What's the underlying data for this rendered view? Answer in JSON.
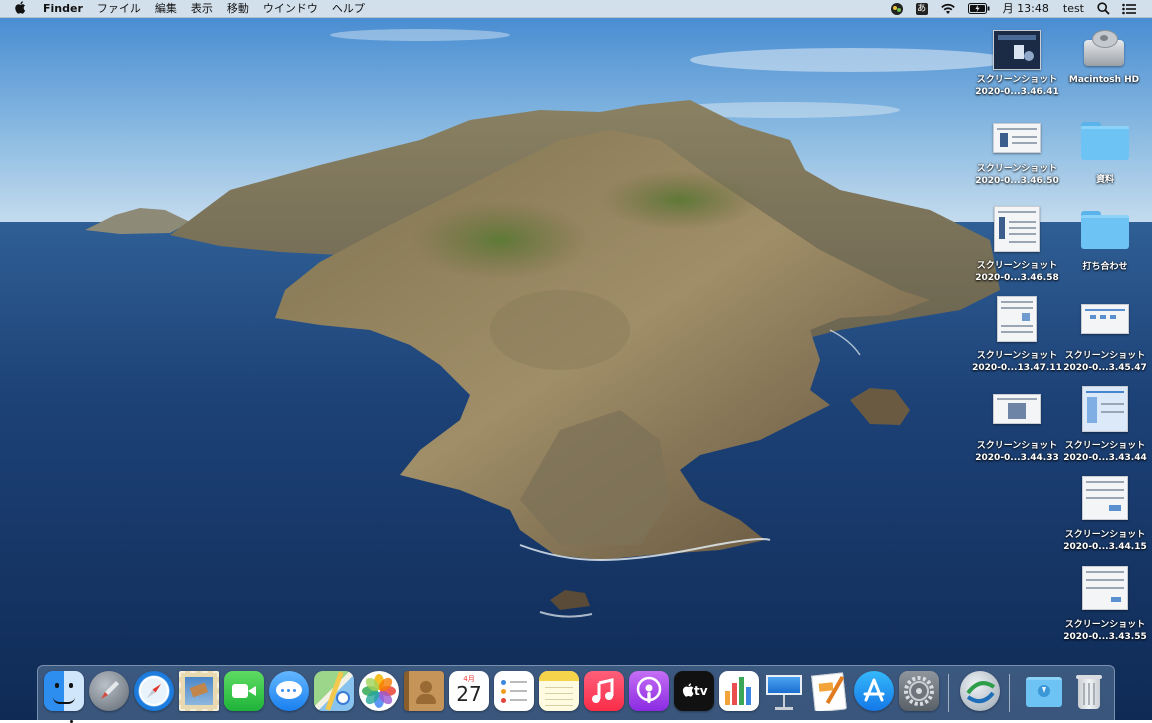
{
  "menubar": {
    "apple_icon": "apple-logo-icon",
    "app_name": "Finder",
    "menus": [
      "ファイル",
      "編集",
      "表示",
      "移動",
      "ウインドウ",
      "ヘルプ"
    ],
    "status": {
      "ime_label": "あ",
      "battery_icon": "battery-charging-icon",
      "wifi_icon": "wifi-icon",
      "clock": "月 13:48",
      "user": "test",
      "search_icon": "spotlight-search-icon",
      "notification_icon": "notification-center-icon"
    }
  },
  "desktop": {
    "icons": [
      {
        "line1": "スクリーンショット",
        "line2": "2020-0...3.46.41",
        "kind": "screenshot-dark"
      },
      {
        "line1": "Macintosh HD",
        "line2": "",
        "kind": "disk"
      },
      {
        "line1": "スクリーンショット",
        "line2": "2020-0...3.46.50",
        "kind": "screenshot"
      },
      {
        "line1": "資料",
        "line2": "",
        "kind": "folder"
      },
      {
        "line1": "スクリーンショット",
        "line2": "2020-0...3.46.58",
        "kind": "screenshot-tall"
      },
      {
        "line1": "打ち合わせ",
        "line2": "",
        "kind": "folder"
      },
      {
        "line1": "スクリーンショット",
        "line2": "2020-0...13.47.11",
        "kind": "screenshot-tall"
      },
      {
        "line1": "スクリーンショット",
        "line2": "2020-0...3.45.47",
        "kind": "screenshot"
      },
      {
        "line1": "スクリーンショット",
        "line2": "2020-0...3.44.33",
        "kind": "screenshot"
      },
      {
        "line1": "スクリーンショット",
        "line2": "2020-0...3.43.44",
        "kind": "screenshot-tall"
      },
      {
        "line1": "スクリーンショット",
        "line2": "2020-0...3.44.15",
        "kind": "screenshot"
      },
      {
        "line1": "スクリーンショット",
        "line2": "2020-0...3.43.55",
        "kind": "screenshot"
      }
    ]
  },
  "dock": {
    "apps": [
      {
        "name": "Finder",
        "icon": "finder-icon",
        "running": true
      },
      {
        "name": "Launchpad",
        "icon": "launchpad-icon",
        "running": false
      },
      {
        "name": "Safari",
        "icon": "safari-icon",
        "running": false
      },
      {
        "name": "Mail",
        "icon": "mail-icon",
        "running": false
      },
      {
        "name": "FaceTime",
        "icon": "facetime-icon",
        "running": false
      },
      {
        "name": "Messages",
        "icon": "messages-icon",
        "running": false
      },
      {
        "name": "Maps",
        "icon": "maps-icon",
        "running": false
      },
      {
        "name": "Photos",
        "icon": "photos-icon",
        "running": false
      },
      {
        "name": "Contacts",
        "icon": "contacts-icon",
        "running": false
      },
      {
        "name": "Calendar",
        "icon": "calendar-icon",
        "running": false,
        "month": "4月",
        "day": "27"
      },
      {
        "name": "Reminders",
        "icon": "reminders-icon",
        "running": false
      },
      {
        "name": "Notes",
        "icon": "notes-icon",
        "running": false
      },
      {
        "name": "Music",
        "icon": "music-icon",
        "running": false
      },
      {
        "name": "Podcasts",
        "icon": "podcasts-icon",
        "running": false
      },
      {
        "name": "TV",
        "icon": "apple-tv-icon",
        "running": false,
        "label": "tv"
      },
      {
        "name": "Numbers",
        "icon": "numbers-icon",
        "running": false
      },
      {
        "name": "Keynote",
        "icon": "keynote-icon",
        "running": false
      },
      {
        "name": "Pages",
        "icon": "pages-icon",
        "running": false
      },
      {
        "name": "App Store",
        "icon": "app-store-icon",
        "running": false
      },
      {
        "name": "System Preferences",
        "icon": "system-preferences-icon",
        "running": false
      }
    ],
    "extras": [
      {
        "name": "Network Assistant",
        "icon": "network-globe-icon"
      },
      {
        "name": "Downloads",
        "icon": "downloads-folder-icon"
      },
      {
        "name": "Trash",
        "icon": "trash-icon"
      }
    ]
  }
}
